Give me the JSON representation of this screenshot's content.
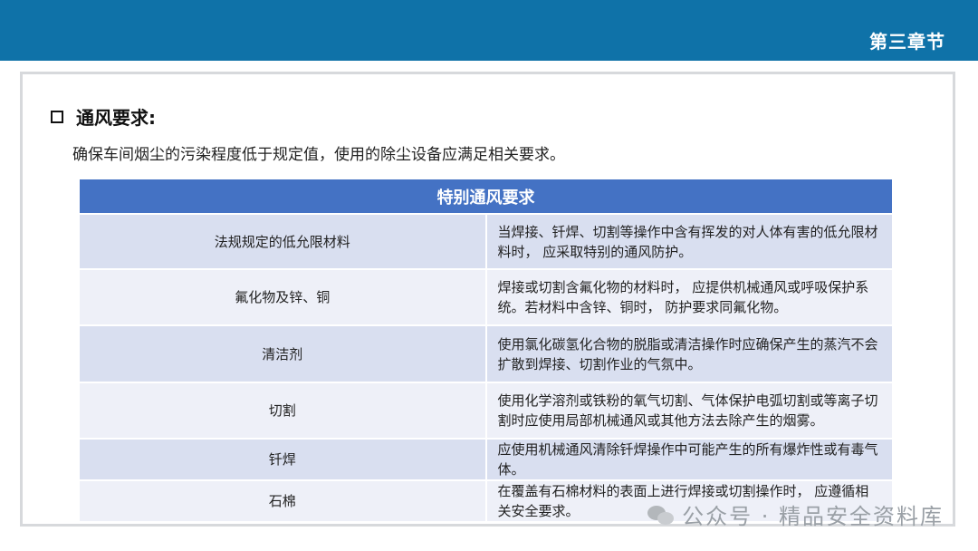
{
  "header": {
    "chapter": "第三章节",
    "bar_color": "#0f72a8"
  },
  "section": {
    "title": "通风要求:",
    "intro": "确保车间烟尘的污染程度低于规定值，使用的除尘设备应满足相关要求。"
  },
  "table": {
    "title": "特别通风要求",
    "header_color": "#4472c4",
    "rows": [
      {
        "category": "法规规定的低允限材料",
        "requirement": "当焊接、钎焊、切割等操作中含有挥发的对人体有害的低允限材料时， 应采取特别的通风防护。"
      },
      {
        "category": "氟化物及锌、铜",
        "requirement": "焊接或切割含氟化物的材料时， 应提供机械通风或呼吸保护系统。若材料中含锌、铜时， 防护要求同氟化物。"
      },
      {
        "category": "清洁剂",
        "requirement": "使用氯化碳氢化合物的脱脂或清洁操作时应确保产生的蒸汽不会扩散到焊接、切割作业的气氛中。"
      },
      {
        "category": "切割",
        "requirement": "使用化学溶剂或铁粉的氧气切割、气体保护电弧切割或等离子切割时应使用局部机械通风或其他方法去除产生的烟雾。"
      },
      {
        "category": "钎焊",
        "requirement": "应使用机械通风清除钎焊操作中可能产生的所有爆炸性或有毒气体。"
      },
      {
        "category": "石棉",
        "requirement": "在覆盖有石棉材料的表面上进行焊接或切割操作时， 应遵循相关安全要求。"
      }
    ]
  },
  "watermark": {
    "icon": "wechat-icon",
    "text": "公众号 · 精品安全资料库"
  }
}
